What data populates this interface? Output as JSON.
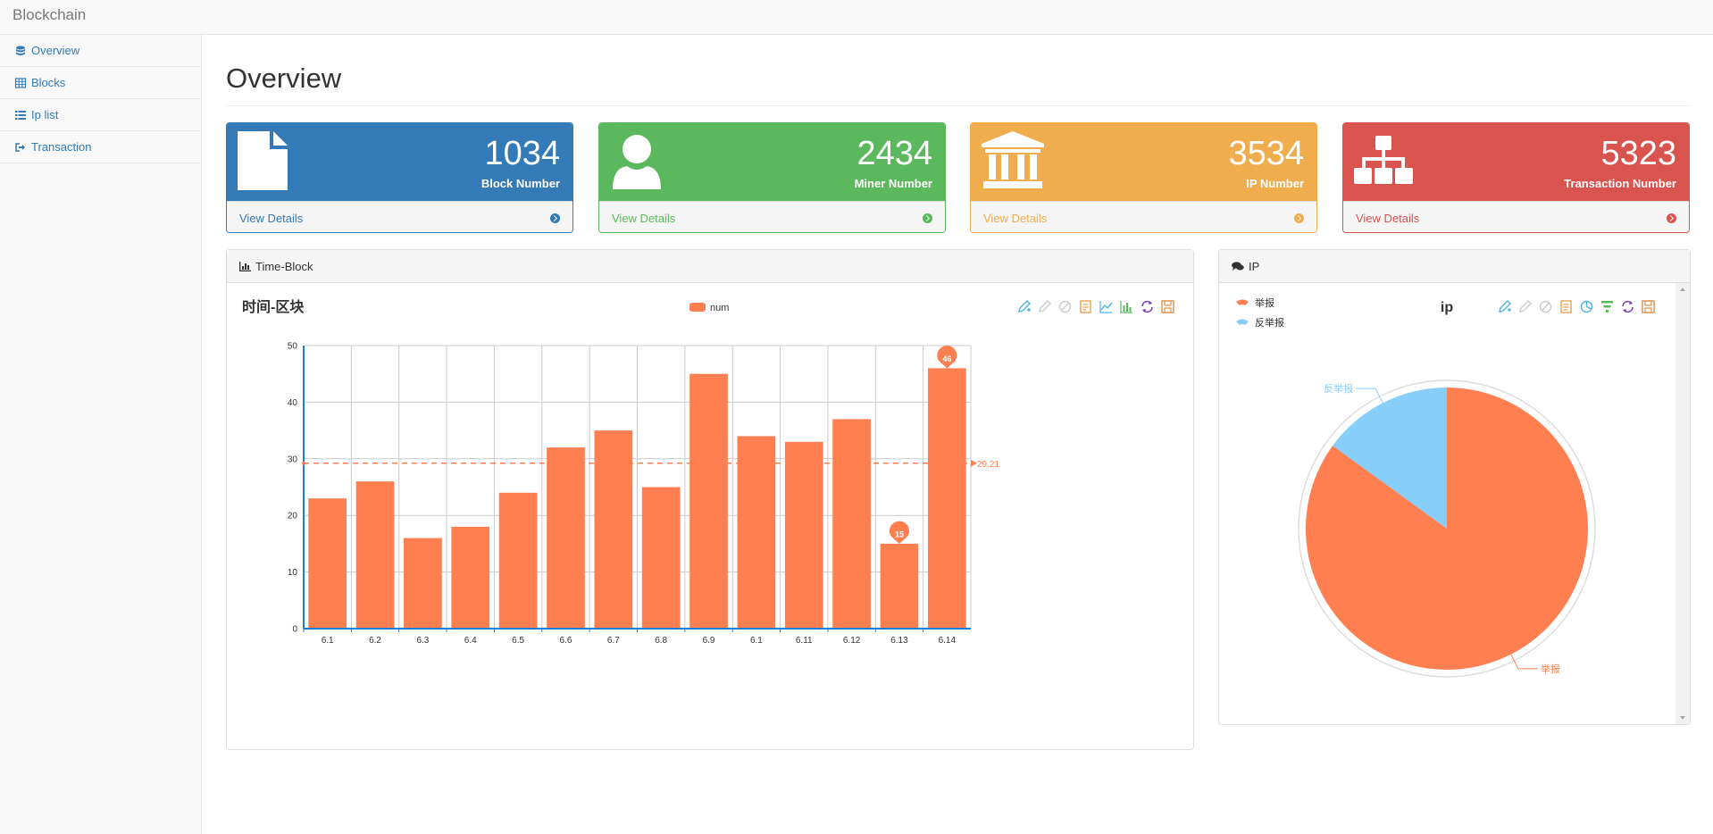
{
  "app": {
    "brand": "Blockchain"
  },
  "sidebar": {
    "items": [
      {
        "label": "Overview",
        "icon": "database-icon"
      },
      {
        "label": "Blocks",
        "icon": "table-icon"
      },
      {
        "label": "Ip list",
        "icon": "list-icon"
      },
      {
        "label": "Transaction",
        "icon": "sign-out-icon"
      }
    ]
  },
  "page": {
    "title": "Overview"
  },
  "cards": [
    {
      "value": "1034",
      "label": "Block Number",
      "link": "View Details",
      "color": "#337ab7",
      "icon": "file-icon"
    },
    {
      "value": "2434",
      "label": "Miner Number",
      "link": "View Details",
      "color": "#5cb85c",
      "icon": "user-icon"
    },
    {
      "value": "3534",
      "label": "IP Number",
      "link": "View Details",
      "color": "#f0ad4e",
      "icon": "bank-icon"
    },
    {
      "value": "5323",
      "label": "Transaction Number",
      "link": "View Details",
      "color": "#d9534f",
      "icon": "sitemap-icon"
    }
  ],
  "panels": {
    "time_block": {
      "title": "Time-Block"
    },
    "ip": {
      "title": "IP"
    }
  },
  "chart_data": [
    {
      "type": "bar",
      "title": "时间-区块",
      "categories": [
        "6.1",
        "6.2",
        "6.3",
        "6.4",
        "6.5",
        "6.6",
        "6.7",
        "6.8",
        "6.9",
        "6.1",
        "6.11",
        "6.12",
        "6.13",
        "6.14"
      ],
      "series": [
        {
          "name": "num",
          "values": [
            23,
            26,
            16,
            18,
            24,
            32,
            35,
            25,
            45,
            34,
            33,
            37,
            15,
            46
          ]
        }
      ],
      "ylim": [
        0,
        50
      ],
      "yticks": [
        0,
        10,
        20,
        30,
        40,
        50
      ],
      "average_line": {
        "value": 29.21,
        "label": "29.21"
      },
      "mark_points": [
        {
          "label": "46",
          "category_index": 13
        },
        {
          "label": "15",
          "category_index": 12
        }
      ],
      "color": "#ff7f50",
      "grid": true,
      "legend": "top-center"
    },
    {
      "type": "pie",
      "title": "ip",
      "slices": [
        {
          "name": "举报",
          "value": 85,
          "color": "#ff7f50"
        },
        {
          "name": "反举报",
          "value": 15,
          "color": "#87cefa"
        }
      ],
      "legend": "top-left"
    }
  ]
}
